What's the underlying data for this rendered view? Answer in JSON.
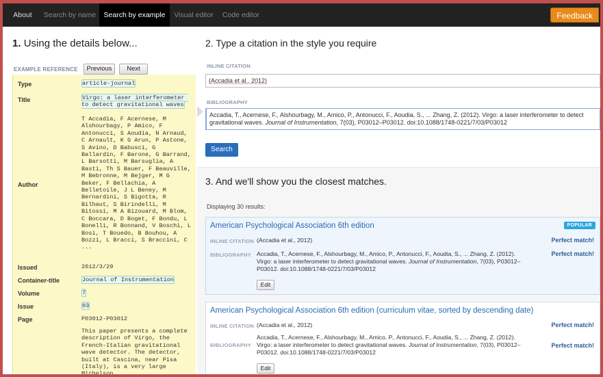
{
  "nav": {
    "items": [
      "About",
      "Search by name",
      "Search by example",
      "Visual editor",
      "Code editor"
    ],
    "active": "Search by example",
    "feedback": "Feedback"
  },
  "left": {
    "heading_num": "1.",
    "heading": "Using the details below...",
    "example_label": "EXAMPLE REFERENCE",
    "prev": "Previous",
    "next": "Next",
    "fields": [
      {
        "key": "Type",
        "value": "article-journal"
      },
      {
        "key": "Title",
        "value": "Virgo: a laser interferometer to detect gravitational waves"
      },
      {
        "key": "Author",
        "value": "T Accadia, F Acernese, M Alshourbagy, P Amico, F Antonucci, S Aoudia, N Arnaud, C Arnault, K G Arun, P Astone, S Avino, D Babusci, G Ballardin, F Barone, G Barrand, L Barsotti, M Barsuglia, A Basti, Th S Bauer, F Beauville, M Bebronne, M Bejger, M G Beker, F Bellachia, A Belletoile, J L Beney, M Bernardini, S Bigotta, R Bilhaut, S Birindelli, M Bitossi, M A Bizouard, M Blom, C Boccara, D Boget, F Bondu, L Bonelli, R Bonnand, V Boschi, L Bosi, T Bouedo, B Bouhou, A Bozzi, L Bracci, S Braccini, C ..."
      },
      {
        "key": "Issued",
        "value": "2012/3/29"
      },
      {
        "key": "Container-title",
        "value": "Journal of Instrumentation"
      },
      {
        "key": "Volume",
        "value": "7"
      },
      {
        "key": "Issue",
        "value": "03"
      },
      {
        "key": "Page",
        "value": "P03012-P03012"
      },
      {
        "key": "",
        "value": "This paper presents a complete description of Virgo, the French-Italian gravitational wave detector. The detector, built at Cascina, near Pisa (Italy), is a very large Michelson"
      }
    ]
  },
  "right": {
    "step2_num": "2.",
    "step2": "Type a citation in the style you require",
    "inline_label": "INLINE CITATION",
    "inline_value": "(Accadia et al., 2012)",
    "bib_label": "BIBLIOGRAPHY",
    "bib_value_a": "Accadia, T., Acernese, F., Alshourbagy, M., Amico, P., Antonucci, F., Aoudia, S., ... Zhang, Z. (2012). Virgo: a laser interferometer to detect gravitational waves.",
    "bib_journal": "Journal of Instrumentation",
    "bib_value_b": ", 7(03), P03012–P03012. doi:10.1088/1748-0221/7/03/P03012",
    "search": "Search",
    "step3_num": "3.",
    "step3": "And we'll show you the closest matches.",
    "displaying": "Displaying 30 results:",
    "results": [
      {
        "title": "American Psychological Association 6th edition",
        "badge": "POPULAR",
        "inline_label": "INLINE CITATION",
        "inline": "(Accadia et al., 2012)",
        "inline_match": "Perfect match!",
        "bib_label": "BIBLIOGRAPHY",
        "bib_a": "Accadia, T., Acernese, F., Alshourbagy, M., Amico, P., Antonucci, F., Aoudia, S., ... Zhang, Z. (2012). Virgo: a laser interferometer to detect gravitational waves.",
        "bib_journal": "Journal of Instrumentation",
        "bib_b": ", 7(03), P03012–P03012. doi:10.1088/1748-0221/7/03/P03012",
        "bib_match": "Perfect match!",
        "edit": "Edit"
      },
      {
        "title": "American Psychological Association 6th edition (curriculum vitae, sorted by descending date)",
        "inline_label": "INLINE CITATION",
        "inline": "(Accadia et al., 2012)",
        "inline_match": "Perfect match!",
        "bib_label": "BIBLIOGRAPHY",
        "bib_a": "Accadia, T., Acernese, F., Alshourbagy, M., Amico, P., Antonucci, F., Aoudia, S., ... Zhang, Z. (2012). Virgo: a laser interferometer to detect gravitational waves.",
        "bib_journal": "Journal of Instrumentation",
        "bib_b": ", 7(03), P03012–P03012. doi:10.1088/1748-0221/7/03/P03012",
        "bib_match": "Perfect match!",
        "edit": "Edit"
      }
    ]
  },
  "colors": {
    "frame": "#c0504d",
    "accent": "#2a6ebb",
    "feedback": "#e8891b",
    "highlight": "#fdf8c8"
  }
}
